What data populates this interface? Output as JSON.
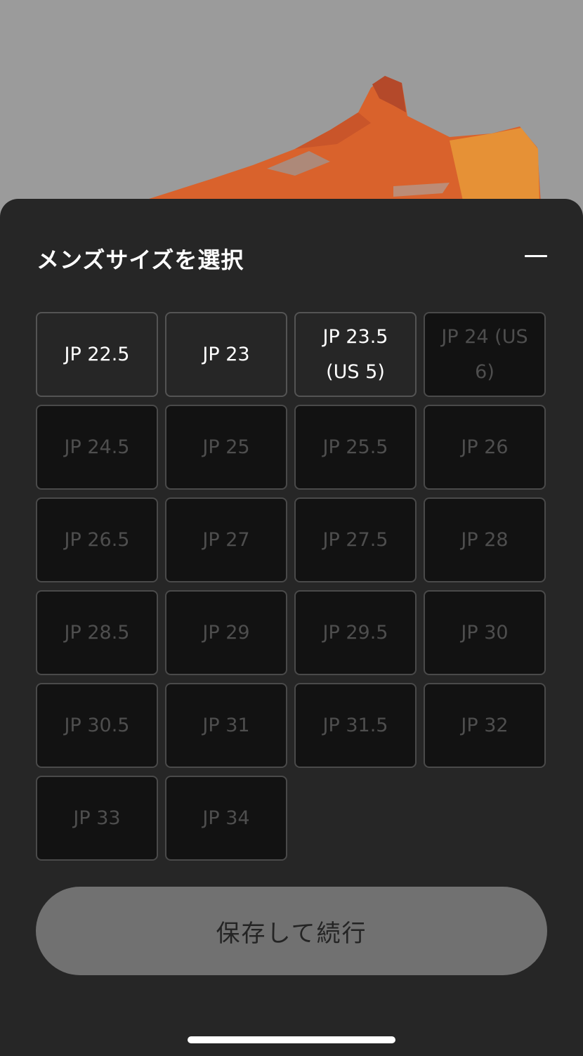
{
  "sheet": {
    "title": "メンズサイズを選択",
    "collapse_icon": "minus-icon"
  },
  "sizes": [
    {
      "label": "JP 22.5",
      "available": true
    },
    {
      "label": "JP 23",
      "available": true
    },
    {
      "label": "JP 23.5 (US 5)",
      "available": true
    },
    {
      "label": "JP 24 (US 6)",
      "available": false
    },
    {
      "label": "JP 24.5",
      "available": false
    },
    {
      "label": "JP 25",
      "available": false
    },
    {
      "label": "JP 25.5",
      "available": false
    },
    {
      "label": "JP 26",
      "available": false
    },
    {
      "label": "JP 26.5",
      "available": false
    },
    {
      "label": "JP 27",
      "available": false
    },
    {
      "label": "JP 27.5",
      "available": false
    },
    {
      "label": "JP 28",
      "available": false
    },
    {
      "label": "JP 28.5",
      "available": false
    },
    {
      "label": "JP 29",
      "available": false
    },
    {
      "label": "JP 29.5",
      "available": false
    },
    {
      "label": "JP 30",
      "available": false
    },
    {
      "label": "JP 30.5",
      "available": false
    },
    {
      "label": "JP 31",
      "available": false
    },
    {
      "label": "JP 31.5",
      "available": false
    },
    {
      "label": "JP 32",
      "available": false
    },
    {
      "label": "JP 33",
      "available": false
    },
    {
      "label": "JP 34",
      "available": false
    }
  ],
  "save_button": {
    "label": "保存して続行"
  },
  "colors": {
    "sheet_bg": "#262626",
    "overlay": "#9a9a9a",
    "shoe_orange": "#e06a2a",
    "button_bg": "#717171"
  }
}
